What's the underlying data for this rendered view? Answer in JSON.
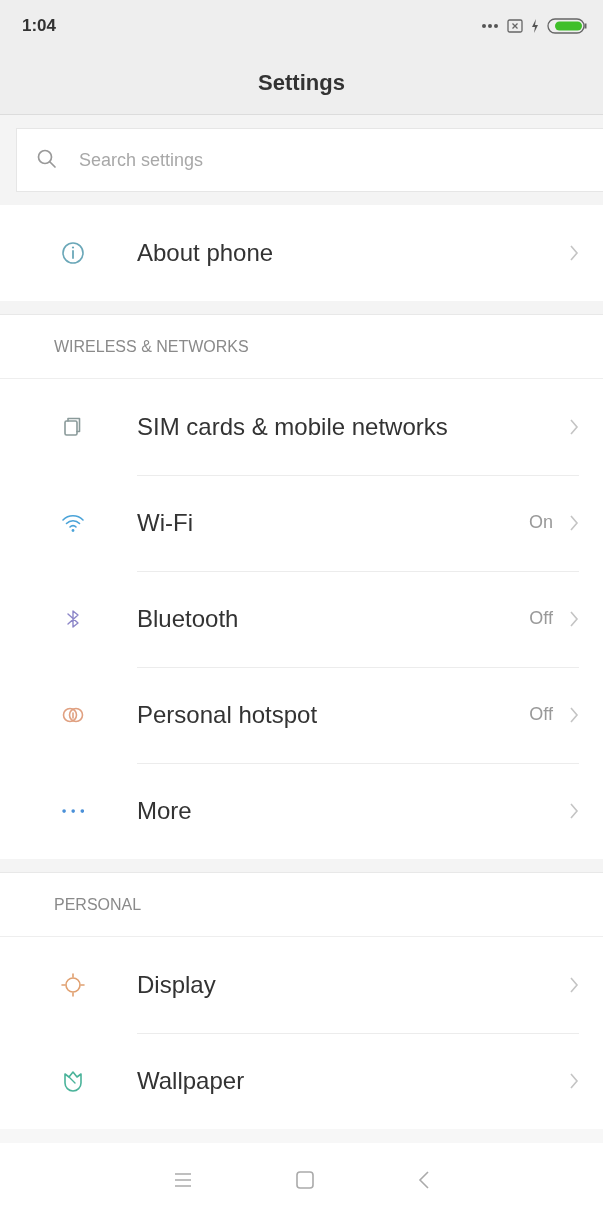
{
  "status_bar": {
    "time": "1:04"
  },
  "title": "Settings",
  "search": {
    "placeholder": "Search settings"
  },
  "sections": [
    {
      "items": [
        {
          "kind": "info",
          "label": "About phone"
        }
      ]
    },
    {
      "header": "WIRELESS & NETWORKS",
      "items": [
        {
          "kind": "sim",
          "label": "SIM cards & mobile networks"
        },
        {
          "kind": "wifi",
          "label": "Wi-Fi",
          "value": "On"
        },
        {
          "kind": "bluetooth",
          "label": "Bluetooth",
          "value": "Off"
        },
        {
          "kind": "hotspot",
          "label": "Personal hotspot",
          "value": "Off"
        },
        {
          "kind": "more",
          "label": "More"
        }
      ]
    },
    {
      "header": "PERSONAL",
      "items": [
        {
          "kind": "display",
          "label": "Display"
        },
        {
          "kind": "wallpaper",
          "label": "Wallpaper"
        }
      ]
    }
  ]
}
